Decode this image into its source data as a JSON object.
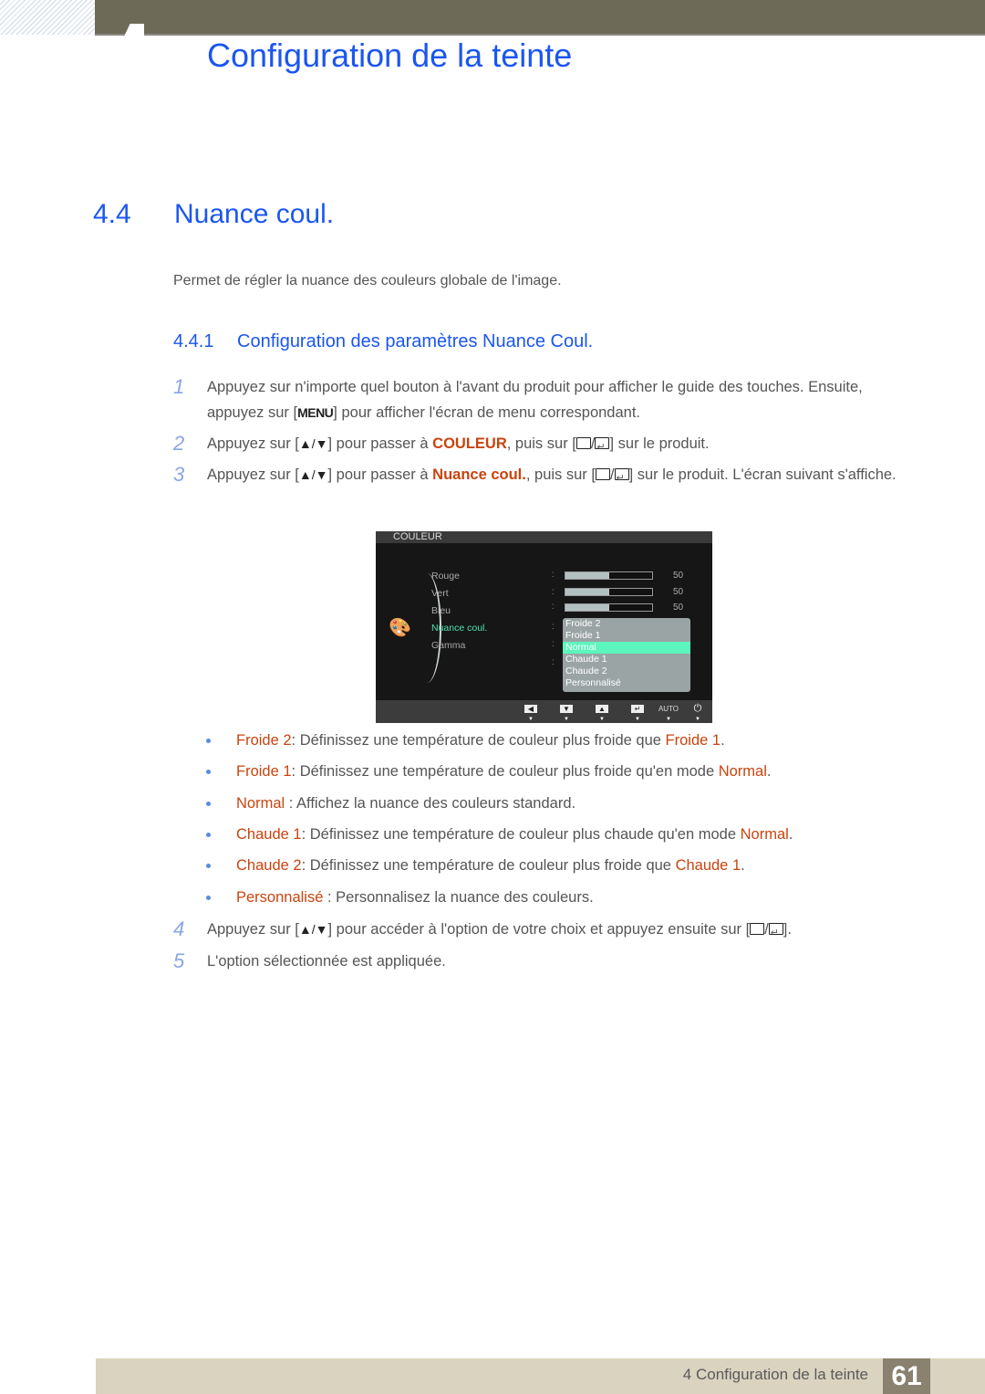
{
  "header": {
    "chapter_title": "Configuration de la teinte"
  },
  "section": {
    "number": "4.4",
    "title": "Nuance coul.",
    "intro": "Permet de régler la nuance des couleurs globale de l'image."
  },
  "subsection": {
    "number": "4.4.1",
    "title": "Configuration des paramètres Nuance Coul."
  },
  "steps": [
    {
      "n": "1",
      "a": "Appuyez sur n'importe quel bouton à l'avant du produit pour afficher le guide des touches. Ensuite, appuyez sur [",
      "key": "MENU",
      "b": "] pour afficher l'écran de menu correspondant."
    },
    {
      "n": "2",
      "a": "Appuyez sur [",
      "arrows": "▲/▼",
      "b": "] pour passer à ",
      "hl": "COULEUR",
      "c": ", puis sur [",
      "d": "] sur le produit."
    },
    {
      "n": "3",
      "a": "Appuyez sur [",
      "arrows": "▲/▼",
      "b": "] pour passer à ",
      "hl": "Nuance coul.",
      "c": ", puis sur [",
      "d": "] sur le produit. L'écran suivant s'affiche."
    },
    {
      "n": "4",
      "a": "Appuyez sur [",
      "arrows": "▲/▼",
      "b": "] pour accéder à l'option de votre choix et appuyez ensuite sur [",
      "d": "]."
    },
    {
      "n": "5",
      "a": "L'option sélectionnée est appliquée."
    }
  ],
  "osd": {
    "menu_title": "COULEUR",
    "items": [
      {
        "label": "Rouge",
        "value": "50",
        "level_percent": 50
      },
      {
        "label": "Vert",
        "value": "50",
        "level_percent": 50
      },
      {
        "label": "Bleu",
        "value": "50",
        "level_percent": 50
      },
      {
        "label": "Nuance coul."
      },
      {
        "label": "Gamma"
      }
    ],
    "selected_item": "Nuance coul.",
    "options": [
      "Froide 2",
      "Froide 1",
      "Normal",
      "Chaude 1",
      "Chaude 2",
      "Personnalisé"
    ],
    "selected_option": "Normal",
    "footer_buttons": [
      "left-icon",
      "down-icon",
      "up-icon",
      "enter-icon",
      "AUTO",
      "power-icon"
    ],
    "auto_label": "AUTO",
    "highlight_color": "#5cf5bd"
  },
  "bullets": [
    {
      "term": "Froide 2",
      "sep": ": ",
      "text": "Définissez une température de couleur plus froide que ",
      "ref": "Froide 1",
      "end": "."
    },
    {
      "term": "Froide 1",
      "sep": ": ",
      "text": "Définissez une température de couleur plus froide qu'en mode ",
      "ref": "Normal",
      "end": "."
    },
    {
      "term": "Normal",
      "sep": " : ",
      "text": "Affichez la nuance des couleurs standard.",
      "ref": "",
      "end": ""
    },
    {
      "term": "Chaude 1",
      "sep": ": ",
      "text": "Définissez une température de couleur plus chaude qu'en mode ",
      "ref": "Normal",
      "end": "."
    },
    {
      "term": "Chaude 2",
      "sep": ": ",
      "text": "Définissez une température de couleur plus froide que ",
      "ref": "Chaude 1",
      "end": "."
    },
    {
      "term": "Personnalisé",
      "sep": " : ",
      "text": "Personnalisez la nuance des couleurs.",
      "ref": "",
      "end": ""
    }
  ],
  "footer": {
    "chapter_label": "4 Configuration de la teinte",
    "page_number": "61"
  },
  "colors": {
    "heading_blue": "#1a56f0",
    "highlight_orange": "#c8440e",
    "topbar": "#6d6b58",
    "footer_bg": "#d9d3c0",
    "pagenum_bg": "#8b8171"
  }
}
